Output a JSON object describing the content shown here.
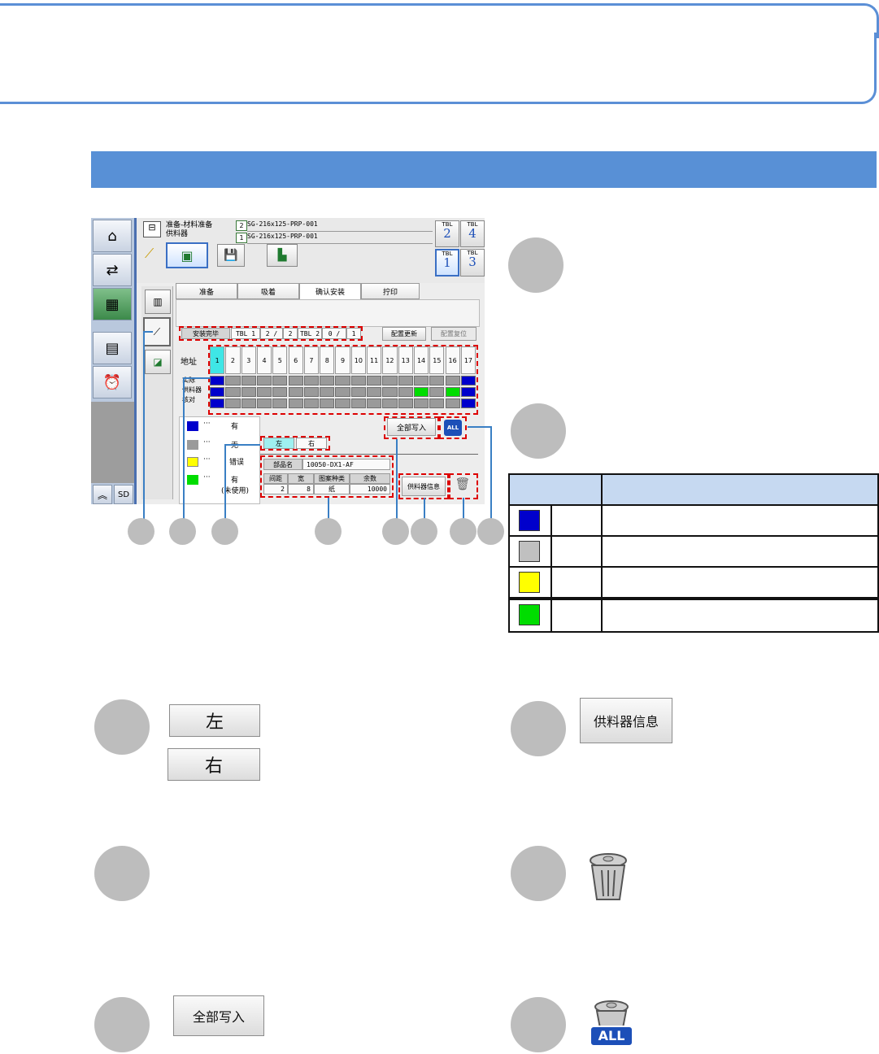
{
  "screen": {
    "header": {
      "line1": "准备-材料准备",
      "line2": "供料器",
      "pgm1": "SG-216x125-PRP-001",
      "pgm2": "SG-216x125-PRP-001",
      "pgm1_badge": "2",
      "pgm2_badge": "1"
    },
    "tbl_buttons": [
      {
        "label": "TBL",
        "num": "2"
      },
      {
        "label": "TBL",
        "num": "4"
      },
      {
        "label": "TBL",
        "num": "1"
      },
      {
        "label": "TBL",
        "num": "3"
      }
    ],
    "tabs": [
      "准备",
      "吸着",
      "确认安装",
      "拧印"
    ],
    "status": {
      "label": "安装完毕",
      "tbl1": "TBL 1",
      "tbl1_val": "2 /",
      "tbl1_total": "2",
      "tbl2": "TBL 2",
      "tbl2_val": "0 /",
      "tbl2_total": "1"
    },
    "update_button": "配置更新",
    "reset_button": "配置复位",
    "address_label": "地址",
    "addresses": [
      "1",
      "2",
      "3",
      "4",
      "5",
      "6",
      "7",
      "8",
      "9",
      "10",
      "11",
      "12",
      "13",
      "14",
      "15",
      "16",
      "17"
    ],
    "row_labels": [
      "实际",
      "供料器",
      "核对"
    ],
    "write_all_button": "全部写入",
    "legend": [
      {
        "color": "#0000cc",
        "dots": "···",
        "text": "有"
      },
      {
        "color": "#9a9a9a",
        "dots": "···",
        "text": "无"
      },
      {
        "color": "#ffff00",
        "dots": "···",
        "text": "错误"
      },
      {
        "color": "#00dd00",
        "dots": "···",
        "text": "有"
      }
    ],
    "legend_note": "(未使用)",
    "side_left": "左",
    "side_right": "右",
    "part_label": "部品名",
    "part_value": "10050-DX1-AF",
    "info_headers": [
      "间距",
      "宽",
      "图案种类",
      "余数"
    ],
    "info_values": [
      "2",
      "8",
      "纸",
      "10000"
    ],
    "feeder_info_button": "供料器信息"
  },
  "grid": {
    "row1": [
      "#0000cc",
      "#9a9a9a",
      "#9a9a9a",
      "#9a9a9a",
      "#9a9a9a",
      "#9a9a9a",
      "#9a9a9a",
      "#9a9a9a",
      "#9a9a9a",
      "#9a9a9a",
      "#9a9a9a",
      "#9a9a9a",
      "#9a9a9a",
      "#9a9a9a",
      "#9a9a9a",
      "#9a9a9a",
      "#0000cc"
    ],
    "row2": [
      "#0000cc",
      "#9a9a9a",
      "#9a9a9a",
      "#9a9a9a",
      "#9a9a9a",
      "#9a9a9a",
      "#9a9a9a",
      "#9a9a9a",
      "#9a9a9a",
      "#9a9a9a",
      "#9a9a9a",
      "#9a9a9a",
      "#9a9a9a",
      "#00dd00",
      "#9a9a9a",
      "#00dd00",
      "#0000cc"
    ],
    "row3": [
      "#0000cc",
      "#9a9a9a",
      "#9a9a9a",
      "#9a9a9a",
      "#9a9a9a",
      "#9a9a9a",
      "#9a9a9a",
      "#9a9a9a",
      "#9a9a9a",
      "#9a9a9a",
      "#9a9a9a",
      "#9a9a9a",
      "#9a9a9a",
      "#9a9a9a",
      "#9a9a9a",
      "#9a9a9a",
      "#0000cc"
    ]
  },
  "color_table": {
    "rows": [
      "#0000cc",
      "#c0c0c0",
      "#ffff00",
      "#00dd00"
    ]
  },
  "detail_buttons": {
    "left": "左",
    "right": "右",
    "feeder_info": "供料器信息",
    "write_all": "全部写入",
    "all_badge": "ALL"
  },
  "colors": {
    "accent": "#5890d6",
    "circle": "#bdbdbd",
    "highlight": "#dd0000"
  }
}
